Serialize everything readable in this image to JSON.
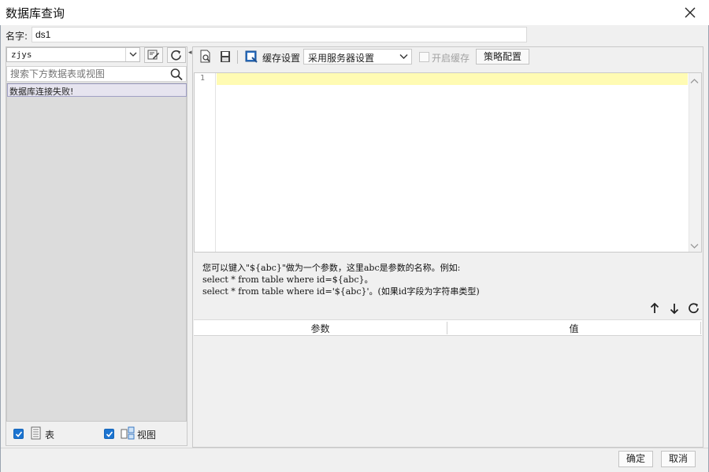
{
  "window": {
    "title": "数据库查询"
  },
  "name_field": {
    "label": "名字:",
    "value": "ds1"
  },
  "left_panel": {
    "connection": "zjys",
    "search_placeholder": "搜索下方数据表或视图",
    "tree_message": "数据库连接失败!",
    "checkboxes": [
      {
        "label": "表",
        "checked": true
      },
      {
        "label": "视图",
        "checked": true
      }
    ]
  },
  "toolbar": {
    "cache_label": "缓存设置",
    "cache_option": "采用服务器设置",
    "enable_cache_label": "开启缓存",
    "enable_cache_checked": false,
    "policy_button": "策略配置"
  },
  "editor": {
    "line_numbers": [
      "1"
    ]
  },
  "hint": {
    "line1": "您可以键入\"${abc}\"做为一个参数，这里abc是参数的名称。例如:",
    "line2": "select * from table where id=${abc}。",
    "line3": "select * from table where id='${abc}'。(如果id字段为字符串类型)"
  },
  "param_table": {
    "headers": [
      "参数",
      "值"
    ]
  },
  "footer": {
    "ok": "确定",
    "cancel": "取消"
  },
  "icons": [
    "close-icon",
    "chevron-down-icon",
    "edit-connection-icon",
    "refresh-icon",
    "search-icon",
    "preview-icon",
    "save-icon",
    "cache-icon",
    "table-icon",
    "view-icon",
    "arrow-up-icon",
    "arrow-down-icon"
  ],
  "colors": {
    "accent_checkbox": "#1b74d1",
    "active_line": "#fffbb3",
    "tree_bg": "#dcdcdc"
  }
}
